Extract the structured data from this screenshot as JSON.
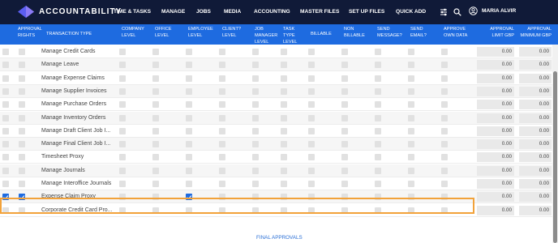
{
  "app": {
    "logo_text": "ACCOUNTABILITY",
    "brand_color": "#101a38",
    "accent_color": "#1e6be0"
  },
  "nav": {
    "items": [
      "TIME & TASKS",
      "MANAGE",
      "JOBS",
      "MEDIA",
      "ACCOUNTING",
      "MASTER FILES",
      "SET UP FILES",
      "QUICK ADD"
    ],
    "icons": [
      "sliders-icon",
      "search-icon",
      "user-circle-icon"
    ],
    "user_name": "MARIA ALVIR"
  },
  "table": {
    "headers": {
      "approval_rights": "APPROVAL RIGHTS",
      "transaction_type": "TRANSACTION TYPE",
      "company_level": "COMPANY LEVEL",
      "office_level": "OFFICE LEVEL",
      "employee_level": "EMPLOYEE LEVEL",
      "client_level": "CLIENT? LEVEL",
      "job_manager_level": "JOB MANAGER LEVEL",
      "task_type_level": "TASK TYPE LEVEL",
      "billable": "BILLABLE",
      "non_billable": "NON BILLABLE",
      "send_message": "SEND MESSAGE?",
      "send_email": "SEND EMAIL?",
      "approve_own_data": "APPROVE OWN DATA",
      "approval_limit": "APPROVAL LIMIT GBP",
      "approval_minimum": "APPROVAL MINIMUM GBP"
    },
    "rows": [
      {
        "type": "Manage Credit Cards",
        "select": false,
        "approval": false,
        "employee": false,
        "limit": "0.00",
        "minimum": "0.00"
      },
      {
        "type": "Manage Leave",
        "select": false,
        "approval": false,
        "employee": false,
        "limit": "0.00",
        "minimum": "0.00"
      },
      {
        "type": "Manage Expense Claims",
        "select": false,
        "approval": false,
        "employee": false,
        "limit": "0.00",
        "minimum": "0.00"
      },
      {
        "type": "Manage Supplier Invoices",
        "select": false,
        "approval": false,
        "employee": false,
        "limit": "0.00",
        "minimum": "0.00"
      },
      {
        "type": "Manage Purchase Orders",
        "select": false,
        "approval": false,
        "employee": false,
        "limit": "0.00",
        "minimum": "0.00"
      },
      {
        "type": "Manage Inventory Orders",
        "select": false,
        "approval": false,
        "employee": false,
        "limit": "0.00",
        "minimum": "0.00"
      },
      {
        "type": "Manage Draft Client Job I...",
        "select": false,
        "approval": false,
        "employee": false,
        "limit": "0.00",
        "minimum": "0.00"
      },
      {
        "type": "Manage Final Client Job I...",
        "select": false,
        "approval": false,
        "employee": false,
        "limit": "0.00",
        "minimum": "0.00"
      },
      {
        "type": "Timesheet Proxy",
        "select": false,
        "approval": false,
        "employee": false,
        "limit": "0.00",
        "minimum": "0.00"
      },
      {
        "type": "Manage Journals",
        "select": false,
        "approval": false,
        "employee": false,
        "limit": "0.00",
        "minimum": "0.00"
      },
      {
        "type": "Manage Interoffice Journals",
        "select": false,
        "approval": false,
        "employee": false,
        "limit": "0.00",
        "minimum": "0.00"
      },
      {
        "type": "Expense Claim Proxy",
        "select": true,
        "approval": true,
        "employee": true,
        "limit": "0.00",
        "minimum": "0.00"
      },
      {
        "type": "Corporate Credit Card Pro...",
        "select": false,
        "approval": false,
        "employee": false,
        "limit": "0.00",
        "minimum": "0.00"
      }
    ]
  },
  "footer": {
    "link": "FINAL APPROVALS"
  }
}
